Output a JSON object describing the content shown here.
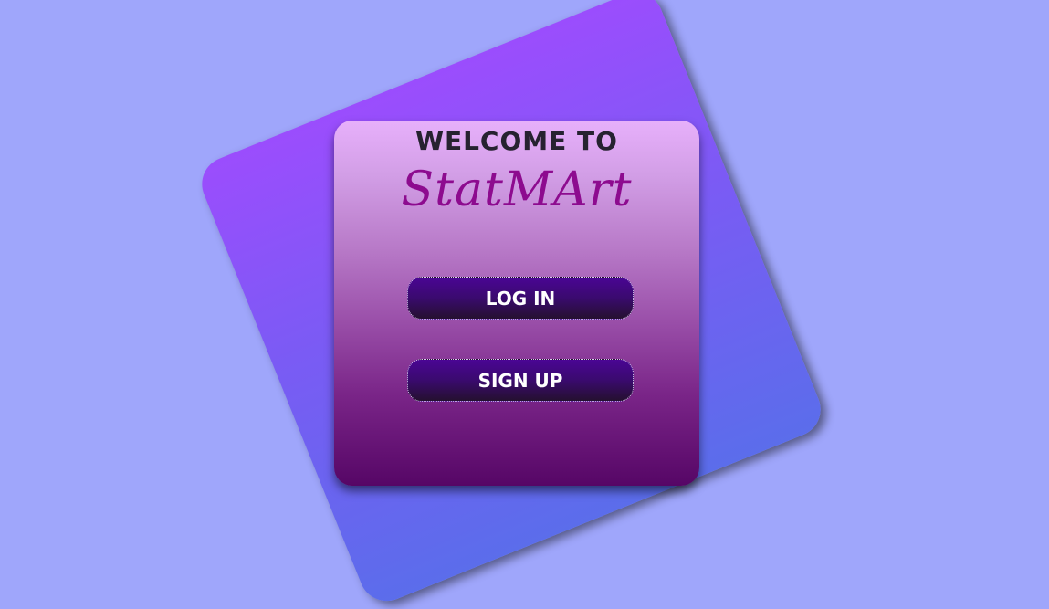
{
  "card": {
    "welcome_text": "WELCOME TO",
    "brand_name": "StatMArt"
  },
  "buttons": {
    "login_label": "LOG IN",
    "signup_label": "SIGN UP"
  },
  "colors": {
    "page_background": "#9fa6fb",
    "brand_text": "#8d0b8f",
    "button_top": "#4a0594",
    "card_bottom": "#560666"
  }
}
